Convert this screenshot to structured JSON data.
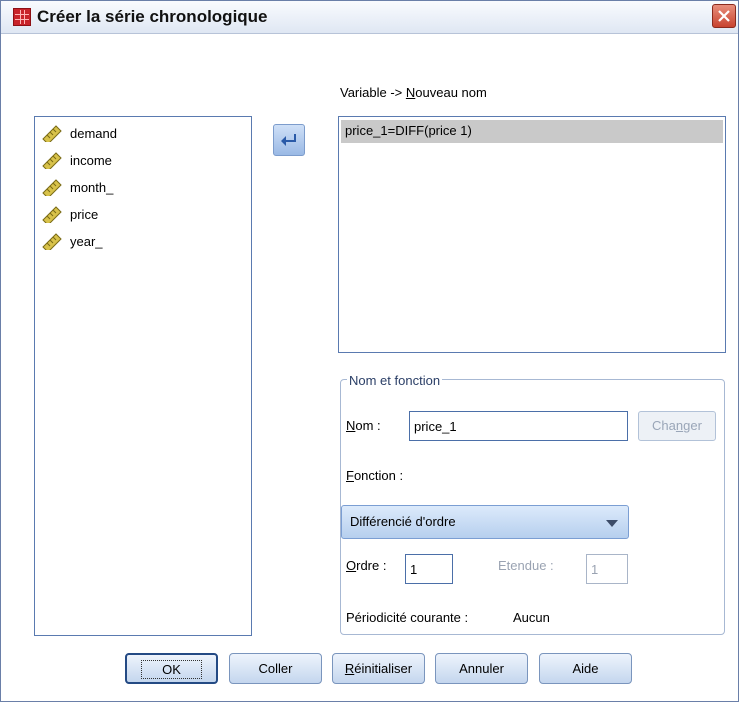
{
  "window": {
    "title": "Créer la série chronologique"
  },
  "variables": {
    "items": [
      {
        "label": "demand",
        "icon": "ruler-scale-icon"
      },
      {
        "label": "income",
        "icon": "ruler-scale-icon"
      },
      {
        "label": "month_",
        "icon": "ruler-scale-icon"
      },
      {
        "label": "price",
        "icon": "ruler-scale-icon"
      },
      {
        "label": "year_",
        "icon": "ruler-scale-icon"
      }
    ]
  },
  "mapping": {
    "header_prefix": "Variable -> ",
    "header_underlined": "N",
    "header_rest": "ouveau nom",
    "items": [
      "price_1=DIFF(price 1)"
    ]
  },
  "group": {
    "legend": "Nom et fonction",
    "name_label_u": "N",
    "name_label_rest": "om :",
    "name_value": "price_1",
    "change_label_pre": "Cha",
    "change_label_u": "n",
    "change_label_post": "ger",
    "function_label_u": "F",
    "function_label_rest": "onction :",
    "function_value": "Différencié d'ordre",
    "order_label_u": "O",
    "order_label_rest": "rdre :",
    "order_value": "1",
    "span_label": "Etendue :",
    "span_value": "1",
    "periodicity_label": "Périodicité courante :",
    "periodicity_value": "Aucun"
  },
  "buttons": {
    "ok": "OK",
    "paste": "Coller",
    "reset_u": "R",
    "reset_rest": "éinitialiser",
    "cancel": "Annuler",
    "help": "Aide"
  },
  "colors": {
    "accent": "#2a5aa8",
    "close": "#c8432f",
    "selection": "#c9c9c9"
  }
}
